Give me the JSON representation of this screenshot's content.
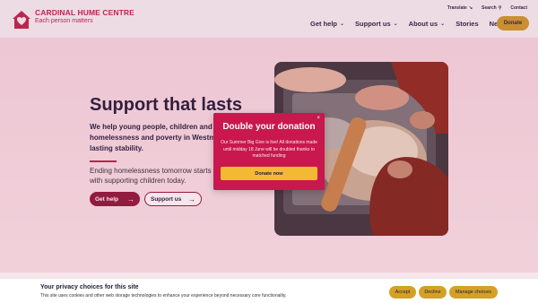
{
  "header": {
    "logo_name": "CARDINAL HUME CENTRE",
    "logo_tag": "Each person matters",
    "utility": {
      "translate": "Translate",
      "search": "Search",
      "contact": "Contact"
    },
    "nav": [
      "Get help",
      "Support us",
      "About us",
      "Stories",
      "News"
    ],
    "donate": "Donate"
  },
  "hero": {
    "title": "Support that lasts",
    "lead": "We help young people, children and families facing homelessness and poverty in Westminster to build lasting stability.",
    "sub": "Ending homelessness tomorrow starts with supporting children today.",
    "btn_gethelp": "Get help",
    "btn_supportus": "Support us"
  },
  "modal": {
    "title": "Double your donation",
    "body": "Our Summer Big Give is live! All donations made until midday 18 June will be doubled thanks to matched funding",
    "button": "Donate now",
    "close": "×"
  },
  "cookie": {
    "title": "Your privacy choices for this site",
    "text": "This site uses cookies and other web storage technologies to enhance your experience beyond necessary core functionality.",
    "accept": "Accept",
    "decline": "Decline",
    "manage": "Manage choices"
  },
  "colors": {
    "brand": "#c41e4a",
    "modal": "#c8184d",
    "gold": "#d4a127",
    "dark": "#1e1e3a"
  }
}
